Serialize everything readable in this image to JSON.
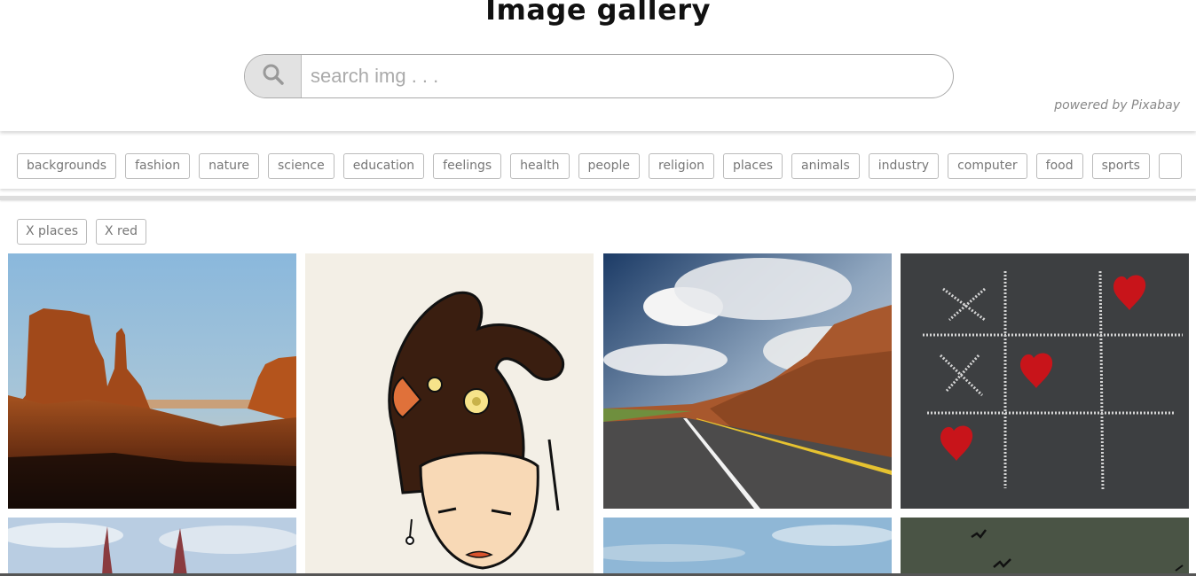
{
  "header": {
    "title": "Image gallery",
    "search_placeholder": "search img . . .",
    "powered_by": "powered by Pixabay"
  },
  "categories": [
    "backgrounds",
    "fashion",
    "nature",
    "science",
    "education",
    "feelings",
    "health",
    "people",
    "religion",
    "places",
    "animals",
    "industry",
    "computer",
    "food",
    "sports",
    ""
  ],
  "active_filters": [
    "X places",
    "X red"
  ],
  "images": [
    {
      "subject": "desert-mesa-monument-valley"
    },
    {
      "subject": "woman-illustration-hair-ornaments"
    },
    {
      "subject": "desert-road-cliffs-clouds"
    },
    {
      "subject": "chalk-tic-tac-toe-red-hearts"
    },
    {
      "subject": "church-spires-blue-sky"
    },
    {
      "subject": "blue-sky-landscape"
    },
    {
      "subject": "dark-sky-birds"
    }
  ],
  "colors": {
    "accent_border": "#bbbbbb",
    "search_button": "#e2e2e2",
    "chip_text": "#777777"
  }
}
